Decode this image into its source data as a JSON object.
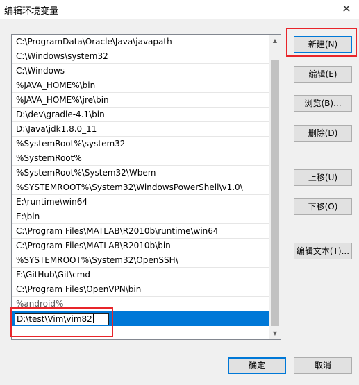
{
  "window": {
    "title": "编辑环境变量",
    "close_glyph": "✕"
  },
  "paths": [
    {
      "text": "C:\\ProgramData\\Oracle\\Java\\javapath"
    },
    {
      "text": "C:\\Windows\\system32"
    },
    {
      "text": "C:\\Windows"
    },
    {
      "text": "%JAVA_HOME%\\bin"
    },
    {
      "text": "%JAVA_HOME%\\jre\\bin"
    },
    {
      "text": "D:\\dev\\gradle-4.1\\bin"
    },
    {
      "text": "D:\\Java\\jdk1.8.0_11"
    },
    {
      "text": "%SystemRoot%\\system32"
    },
    {
      "text": "%SystemRoot%"
    },
    {
      "text": "%SystemRoot%\\System32\\Wbem"
    },
    {
      "text": "%SYSTEMROOT%\\System32\\WindowsPowerShell\\v1.0\\"
    },
    {
      "text": "E:\\runtime\\win64"
    },
    {
      "text": "E:\\bin"
    },
    {
      "text": "C:\\Program Files\\MATLAB\\R2010b\\runtime\\win64"
    },
    {
      "text": "C:\\Program Files\\MATLAB\\R2010b\\bin"
    },
    {
      "text": "%SYSTEMROOT%\\System32\\OpenSSH\\"
    },
    {
      "text": "F:\\GitHub\\Git\\cmd"
    },
    {
      "text": "C:\\Program Files\\OpenVPN\\bin"
    },
    {
      "text": "%android%"
    }
  ],
  "editing": {
    "value": "D:\\test\\Vim\\vim82"
  },
  "buttons": {
    "new": "新建(N)",
    "edit": "编辑(E)",
    "browse": "浏览(B)...",
    "delete": "删除(D)",
    "move_up": "上移(U)",
    "move_down": "下移(O)",
    "edit_text": "编辑文本(T)...",
    "ok": "确定",
    "cancel": "取消"
  },
  "colors": {
    "selection": "#0078d7",
    "annotation": "#e8252a"
  }
}
